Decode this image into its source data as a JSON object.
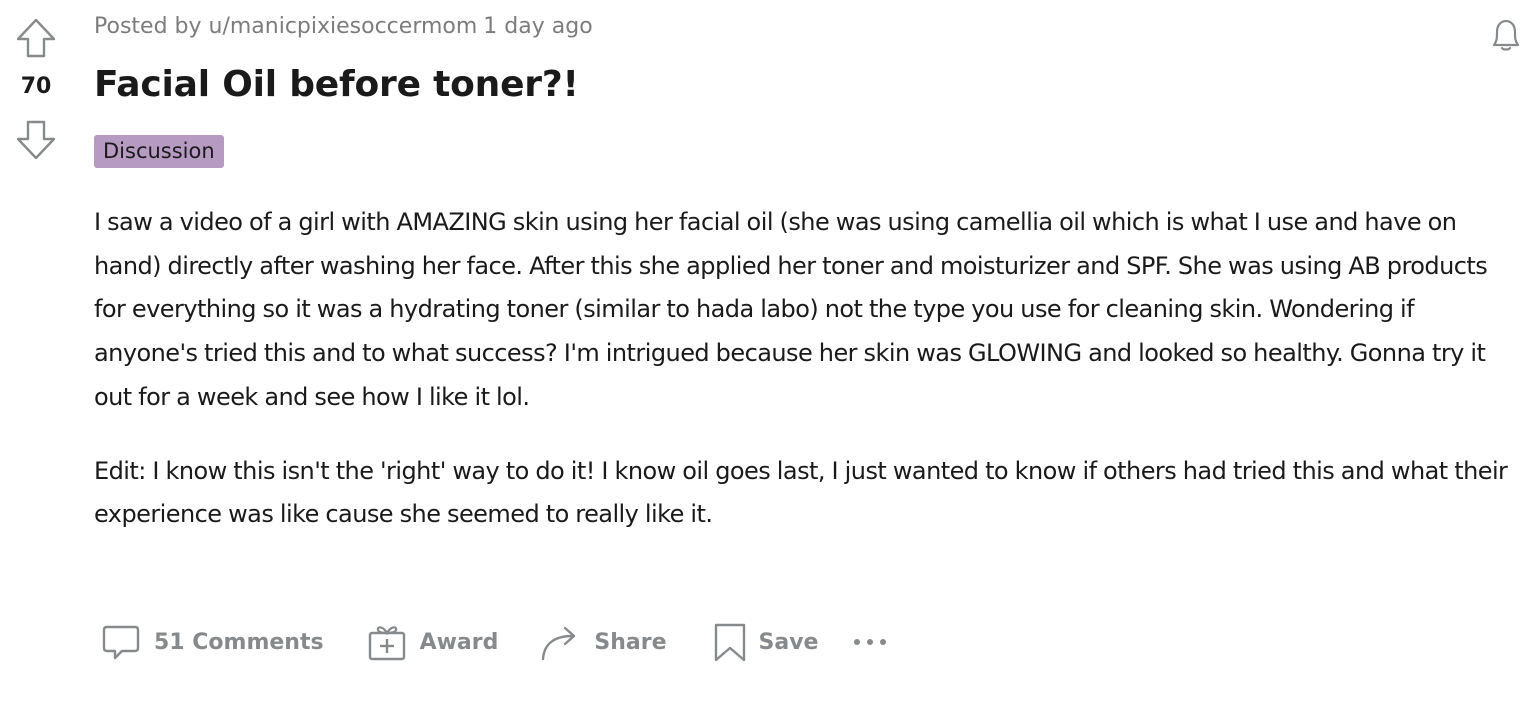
{
  "post": {
    "votes": "70",
    "posted_by": "Posted by u/manicpixiesoccermom",
    "time_ago": "1 day ago",
    "title": "Facial Oil before toner?!",
    "flair": "Discussion",
    "flair_color": "#b69ac1",
    "body": [
      "I saw a video of a girl with AMAZING skin using her facial oil (she was using camellia oil which is what I use and have on hand) directly after washing her face. After this she applied her toner and moisturizer and SPF. She was using AB products for everything so it was a hydrating toner (similar to hada labo) not the type you use for cleaning skin. Wondering if anyone's tried this and to what success? I'm intrigued because her skin was GLOWING and looked so healthy. Gonna try it out for a week and see how I like it lol.",
      "Edit: I know this isn't the 'right' way to do it! I know oil goes last, I just wanted to know if others had tried this and what their experience was like cause she seemed to really like it."
    ]
  },
  "actions": {
    "comments_label": "51 Comments",
    "award_label": "Award",
    "share_label": "Share",
    "save_label": "Save"
  },
  "icons": {
    "upvote": "arrow-up-icon",
    "downvote": "arrow-down-icon",
    "notify": "bell-icon",
    "comments": "comment-bubble-icon",
    "award": "gift-icon",
    "share": "share-arrow-icon",
    "save": "bookmark-icon",
    "more": "more-dots-icon"
  },
  "colors": {
    "text": "#1a1a1b",
    "muted": "#7c7c7c",
    "action": "#878a8c"
  }
}
